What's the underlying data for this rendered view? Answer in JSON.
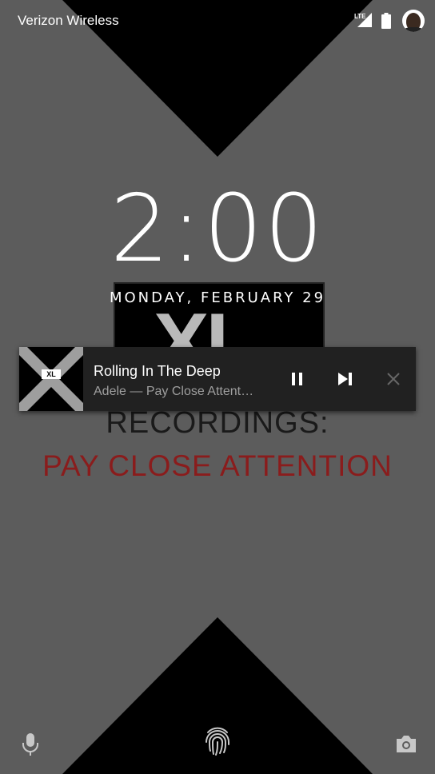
{
  "status_bar": {
    "carrier": "Verizon Wireless",
    "network": "LTE",
    "icons": [
      "signal-icon",
      "battery-icon",
      "avatar"
    ]
  },
  "lockscreen": {
    "time": "2:00",
    "date": "MONDAY, FEBRUARY 29"
  },
  "wallpaper": {
    "album_text": "XL",
    "recordings": "RECORDINGS:",
    "subtitle": "PAY CLOSE ATTENTION",
    "colors": {
      "background": "#5c5c5c",
      "triangle": "#000000",
      "accent_red": "#8a1c1c"
    }
  },
  "media_notification": {
    "title": "Rolling In The Deep",
    "subtitle": "Adele — Pay Close Attent…",
    "thumb_label": "XL",
    "controls": [
      "pause-icon",
      "skip-next-icon",
      "close-icon"
    ]
  },
  "bottom": {
    "icons": [
      "microphone-icon",
      "fingerprint-icon",
      "camera-icon"
    ]
  }
}
